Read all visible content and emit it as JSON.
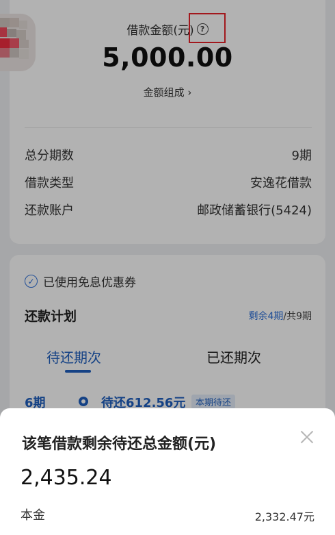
{
  "loan": {
    "amount_label": "借款金额(元)",
    "help_glyph": "?",
    "amount": "5,000.00",
    "composition_link": "金额组成 ›",
    "details": [
      {
        "label": "总分期数",
        "value": "9期"
      },
      {
        "label": "借款类型",
        "value": "安逸花借款"
      },
      {
        "label": "还款账户",
        "value": "邮政储蓄银行(5424)"
      }
    ]
  },
  "plan": {
    "coupon_text": "已使用免息优惠券",
    "check_glyph": "✓",
    "title": "还款计划",
    "remaining": "剩余4期",
    "total_periods": "/共9期",
    "tabs": [
      "待还期次",
      "已还期次"
    ],
    "current": {
      "period": "6期",
      "amount": "待还612.56元",
      "badge": "本期待还"
    }
  },
  "sheet": {
    "title": "该笔借款剩余待还总金额(元)",
    "total": "2,435.24",
    "principal_label": "本金",
    "principal_value": "2,332.47元"
  },
  "colors": {
    "accent": "#1f5fbf",
    "highlight_box": "#e8232a"
  }
}
